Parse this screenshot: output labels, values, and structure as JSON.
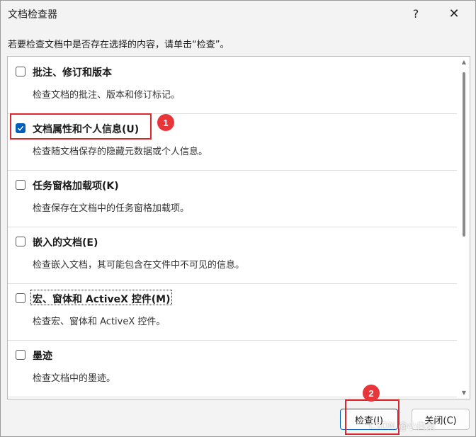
{
  "window": {
    "title": "文档检查器",
    "help_glyph": "?",
    "close_glyph": "✕"
  },
  "instruction": "若要检查文档中是否存在选择的内容，请单击“检查”。",
  "items": [
    {
      "label": "批注、修订和版本",
      "description": "检查文档的批注、版本和修订标记。",
      "checked": false
    },
    {
      "label": "文档属性和个人信息(U)",
      "description": "检查随文档保存的隐藏元数据或个人信息。",
      "checked": true
    },
    {
      "label": "任务窗格加载项(K)",
      "description": "检查保存在文档中的任务窗格加载项。",
      "checked": false
    },
    {
      "label": "嵌入的文档(E)",
      "description": "检查嵌入文档，其可能包含在文件中不可见的信息。",
      "checked": false
    },
    {
      "label": "宏、窗体和 ActiveX 控件(M)",
      "description": "检查宏、窗体和 ActiveX 控件。",
      "checked": false
    },
    {
      "label": "墨迹",
      "description": "检查文档中的墨迹。",
      "checked": false
    }
  ],
  "annotations": {
    "badge_1": "1",
    "badge_2": "2"
  },
  "buttons": {
    "inspect": "检查(I)",
    "close": "关闭(C)"
  },
  "watermark": "CSDN @小白菜",
  "colors": {
    "accent": "#005fb8",
    "annotation_red": "#e0262d"
  }
}
